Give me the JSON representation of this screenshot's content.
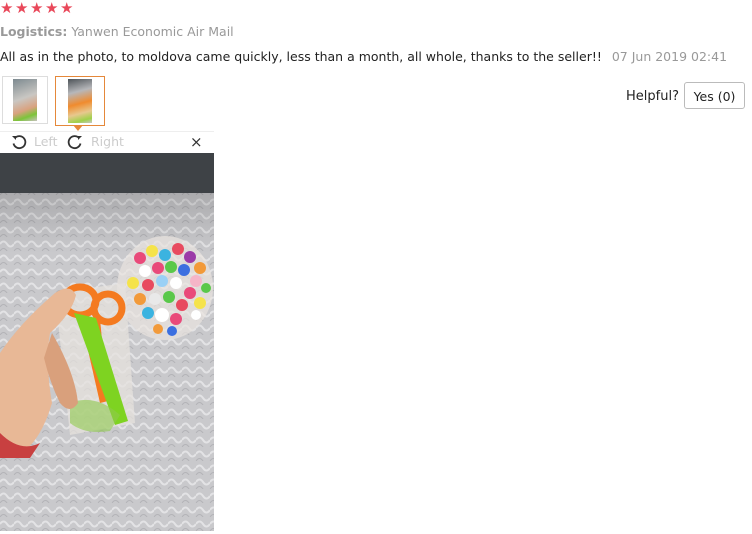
{
  "rating": {
    "stars": 5,
    "color": "#e9485a"
  },
  "logistics": {
    "label": "Logistics:",
    "value": "Yanwen Economic Air Mail"
  },
  "review": {
    "text": "All as in the photo, to moldova came quickly, less than a month, all whole, thanks to the seller!!",
    "date": "07 Jun 2019 02:41"
  },
  "thumbnails": {
    "selected": 2,
    "accent": "#e5883a"
  },
  "helpful": {
    "label": "Helpful?",
    "yes_button": "Yes (0)"
  },
  "viewer": {
    "rotate_left": "Left",
    "rotate_right": "Right",
    "close": "×"
  }
}
